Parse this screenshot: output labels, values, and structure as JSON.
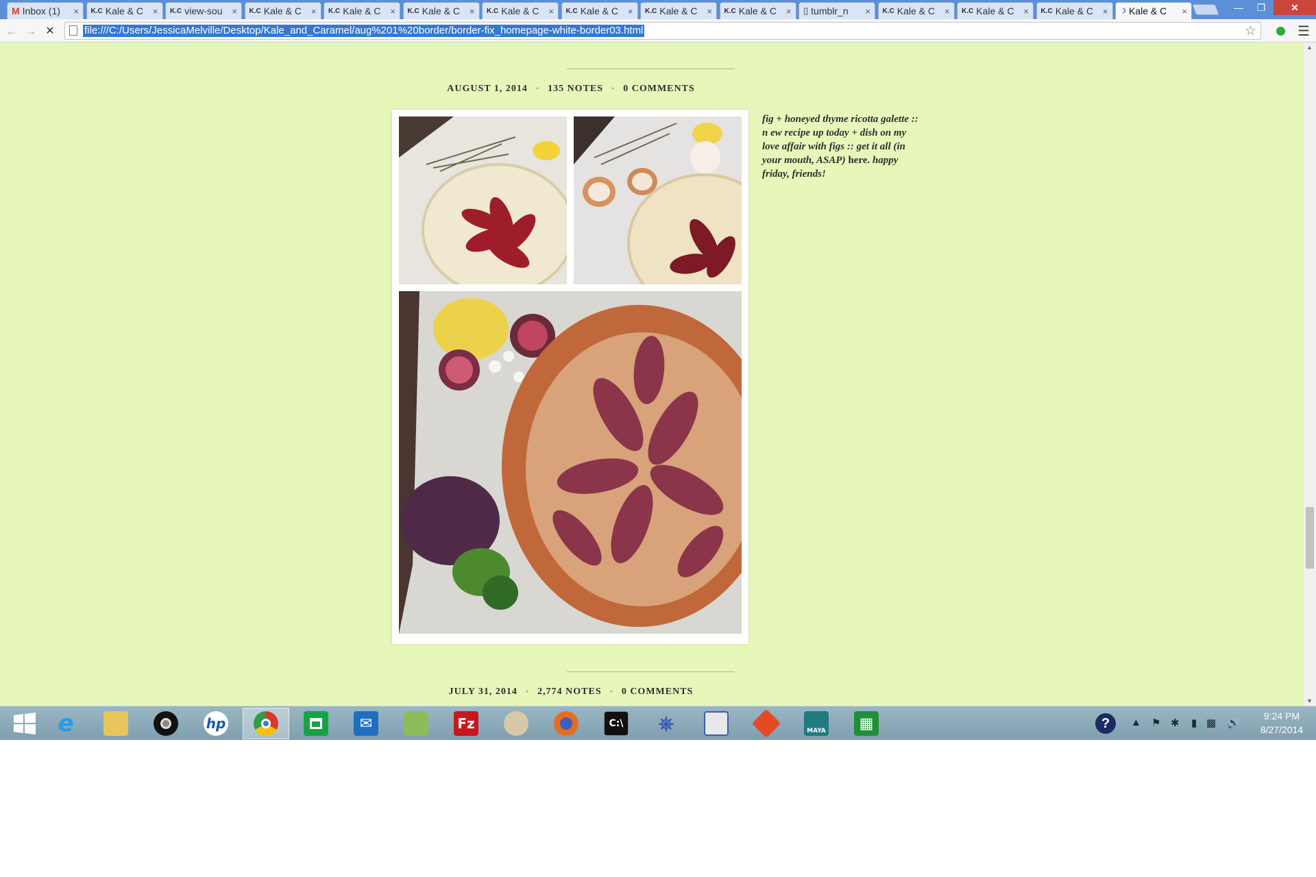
{
  "browser": {
    "tabs": [
      {
        "favicon": "gmail-icon",
        "title": "Inbox (1)"
      },
      {
        "favicon": "kc-icon",
        "title": "Kale & C"
      },
      {
        "favicon": "kc-icon",
        "title": "view-sou"
      },
      {
        "favicon": "kc-icon",
        "title": "Kale & C"
      },
      {
        "favicon": "kc-icon",
        "title": "Kale & C"
      },
      {
        "favicon": "kc-icon",
        "title": "Kale & C"
      },
      {
        "favicon": "kc-icon",
        "title": "Kale & C"
      },
      {
        "favicon": "kc-icon",
        "title": "Kale & C"
      },
      {
        "favicon": "kc-icon",
        "title": "Kale & C"
      },
      {
        "favicon": "kc-icon",
        "title": "Kale & C"
      },
      {
        "favicon": "doc-icon",
        "title": "tumblr_n"
      },
      {
        "favicon": "kc-icon",
        "title": "Kale & C"
      },
      {
        "favicon": "kc-icon",
        "title": "Kale & C"
      },
      {
        "favicon": "kc-icon",
        "title": "Kale & C"
      },
      {
        "favicon": "loading-icon",
        "title": "Kale & C",
        "active": true
      }
    ],
    "favicon_text": "K.C",
    "close_glyph": "×",
    "url": "file:///C:/Users/JessicaMelville/Desktop/Kale_and_Caramel/aug%201%20border/border-fix_homepage-white-border03.html",
    "window_controls": {
      "minimize": "—",
      "maximize": "❐",
      "close": "✕"
    }
  },
  "page": {
    "background": "#e7f7b9",
    "post": {
      "date": "AUGUST 1, 2014",
      "notes": "135 NOTES",
      "comments": "0 COMMENTS",
      "caption_italic_1": "fig + honeyed thyme ricotta galette :: n ew recipe up today + dish on my love affair with figs :: get it all (in your mouth, ASAP)",
      "caption_plain": "here.",
      "caption_italic_2": "happy friday, friends!",
      "images": [
        "galette-before-baking",
        "galette-with-eggs",
        "baked-fig-galette"
      ]
    },
    "next_post": {
      "date": "JULY 31, 2014",
      "notes": "2,774 NOTES",
      "comments": "0 COMMENTS"
    },
    "separator": "•"
  },
  "taskbar": {
    "items": [
      "windows-start-icon",
      "internet-explorer-icon",
      "file-explorer-icon",
      "webcam-icon",
      "hp-icon",
      "chrome-icon",
      "store-icon",
      "mail-icon",
      "notepad-icon",
      "filezilla-icon",
      "paint-icon",
      "firefox-icon",
      "command-prompt-icon",
      "network-icon",
      "remote-desktop-icon",
      "git-icon",
      "maya-icon",
      "calculator-icon"
    ],
    "labels": {
      "hp": "hp",
      "filezilla": "Fz",
      "maya": "MAYA",
      "help": "?"
    },
    "clock_time": "9:24 PM",
    "clock_date": "8/27/2014",
    "colors": {
      "chrome": "#2f9e45",
      "store": "#17a344",
      "mail": "#1d6fc2",
      "filezilla": "#c9171c",
      "firefox": "#e76d1d",
      "git": "#e64a24",
      "calculator": "#1f8f3a"
    }
  }
}
